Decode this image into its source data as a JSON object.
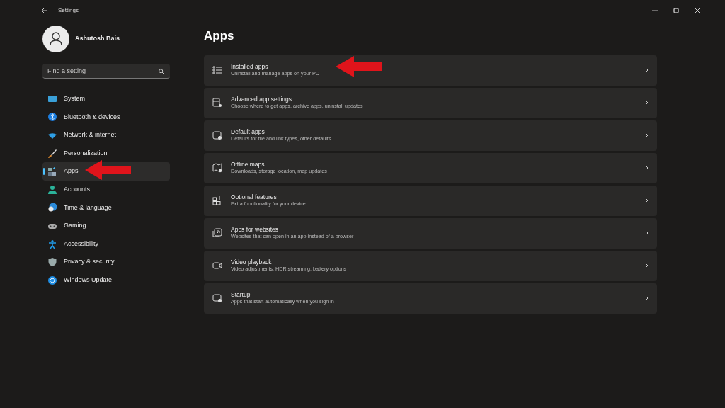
{
  "window": {
    "title": "Settings"
  },
  "user": {
    "name": "Ashutosh Bais"
  },
  "search": {
    "placeholder": "Find a setting"
  },
  "sidebar": {
    "items": [
      {
        "label": "System",
        "selected": false
      },
      {
        "label": "Bluetooth & devices",
        "selected": false
      },
      {
        "label": "Network & internet",
        "selected": false
      },
      {
        "label": "Personalization",
        "selected": false
      },
      {
        "label": "Apps",
        "selected": true
      },
      {
        "label": "Accounts",
        "selected": false
      },
      {
        "label": "Time & language",
        "selected": false
      },
      {
        "label": "Gaming",
        "selected": false
      },
      {
        "label": "Accessibility",
        "selected": false
      },
      {
        "label": "Privacy & security",
        "selected": false
      },
      {
        "label": "Windows Update",
        "selected": false
      }
    ]
  },
  "page": {
    "title": "Apps",
    "items": [
      {
        "title": "Installed apps",
        "subtitle": "Uninstall and manage apps on your PC"
      },
      {
        "title": "Advanced app settings",
        "subtitle": "Choose where to get apps, archive apps, uninstall updates"
      },
      {
        "title": "Default apps",
        "subtitle": "Defaults for file and link types, other defaults"
      },
      {
        "title": "Offline maps",
        "subtitle": "Downloads, storage location, map updates"
      },
      {
        "title": "Optional features",
        "subtitle": "Extra functionality for your device"
      },
      {
        "title": "Apps for websites",
        "subtitle": "Websites that can open in an app instead of a browser"
      },
      {
        "title": "Video playback",
        "subtitle": "Video adjustments, HDR streaming, battery options"
      },
      {
        "title": "Startup",
        "subtitle": "Apps that start automatically when you sign in"
      }
    ]
  }
}
